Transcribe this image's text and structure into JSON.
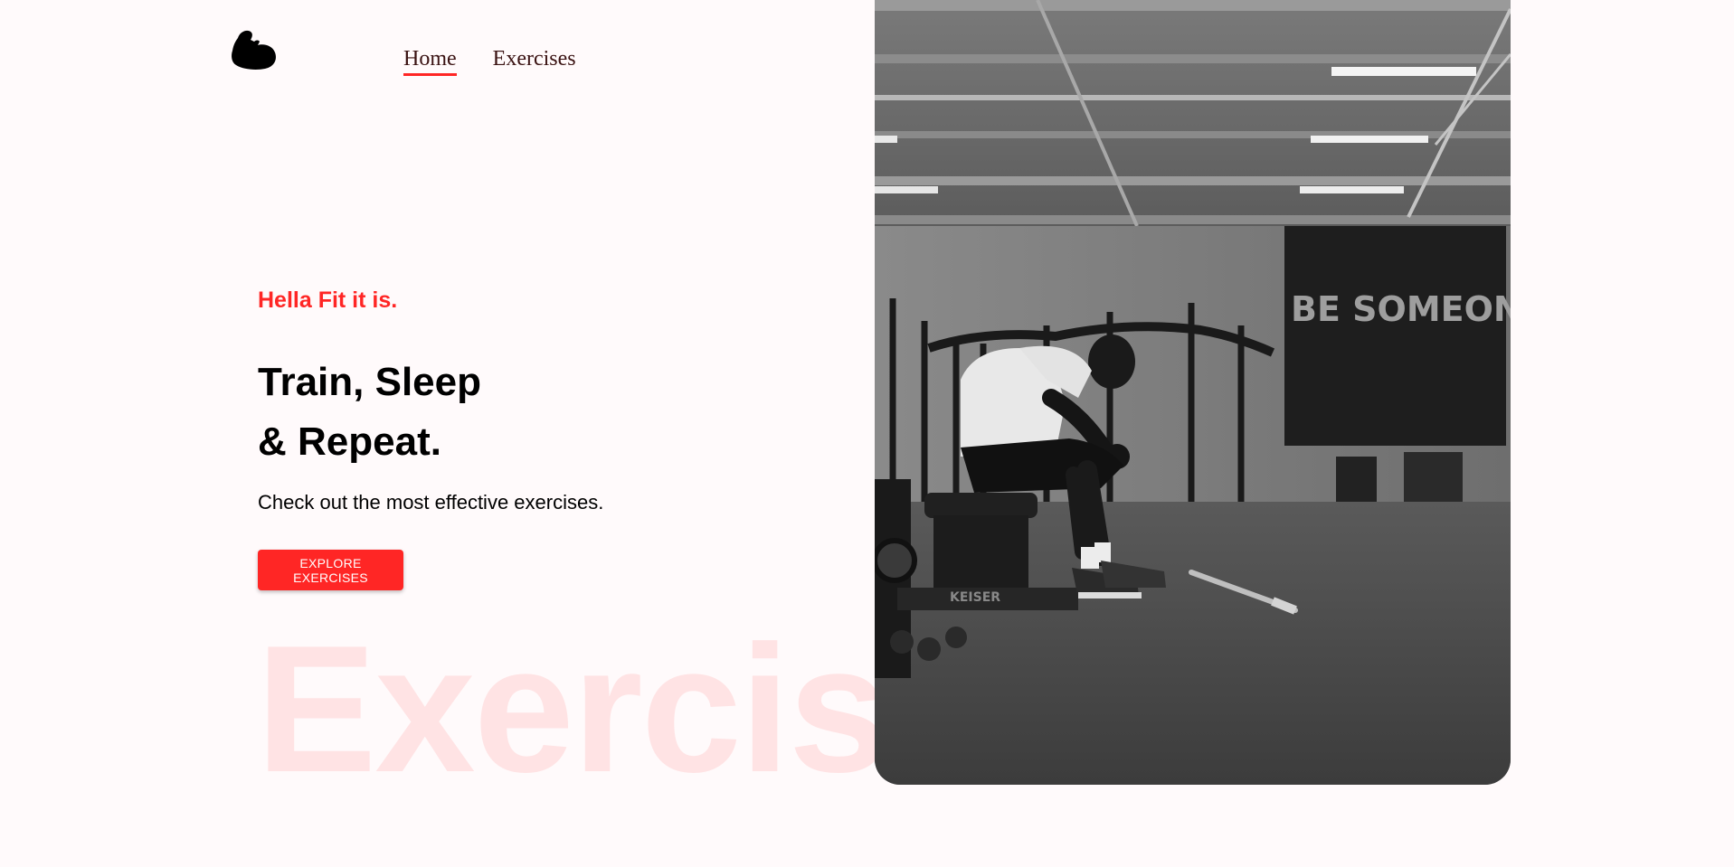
{
  "nav": {
    "logo_icon": "flexed-bicep-icon",
    "links": [
      {
        "label": "Home",
        "active": true
      },
      {
        "label": "Exercises",
        "active": false
      }
    ],
    "active_underline_color": "#ff2625"
  },
  "hero": {
    "tagline": "Hella Fit it is.",
    "headline_line1": "Train, Sleep",
    "headline_line2": "& Repeat.",
    "subtext": "Check out the most effective exercises.",
    "cta_label": "EXPLORE EXERCISES",
    "watermark": "Exercise",
    "wall_sign": "BE SOMEONE",
    "equipment_brand": "KEISER",
    "accent_color": "#ff2625"
  }
}
